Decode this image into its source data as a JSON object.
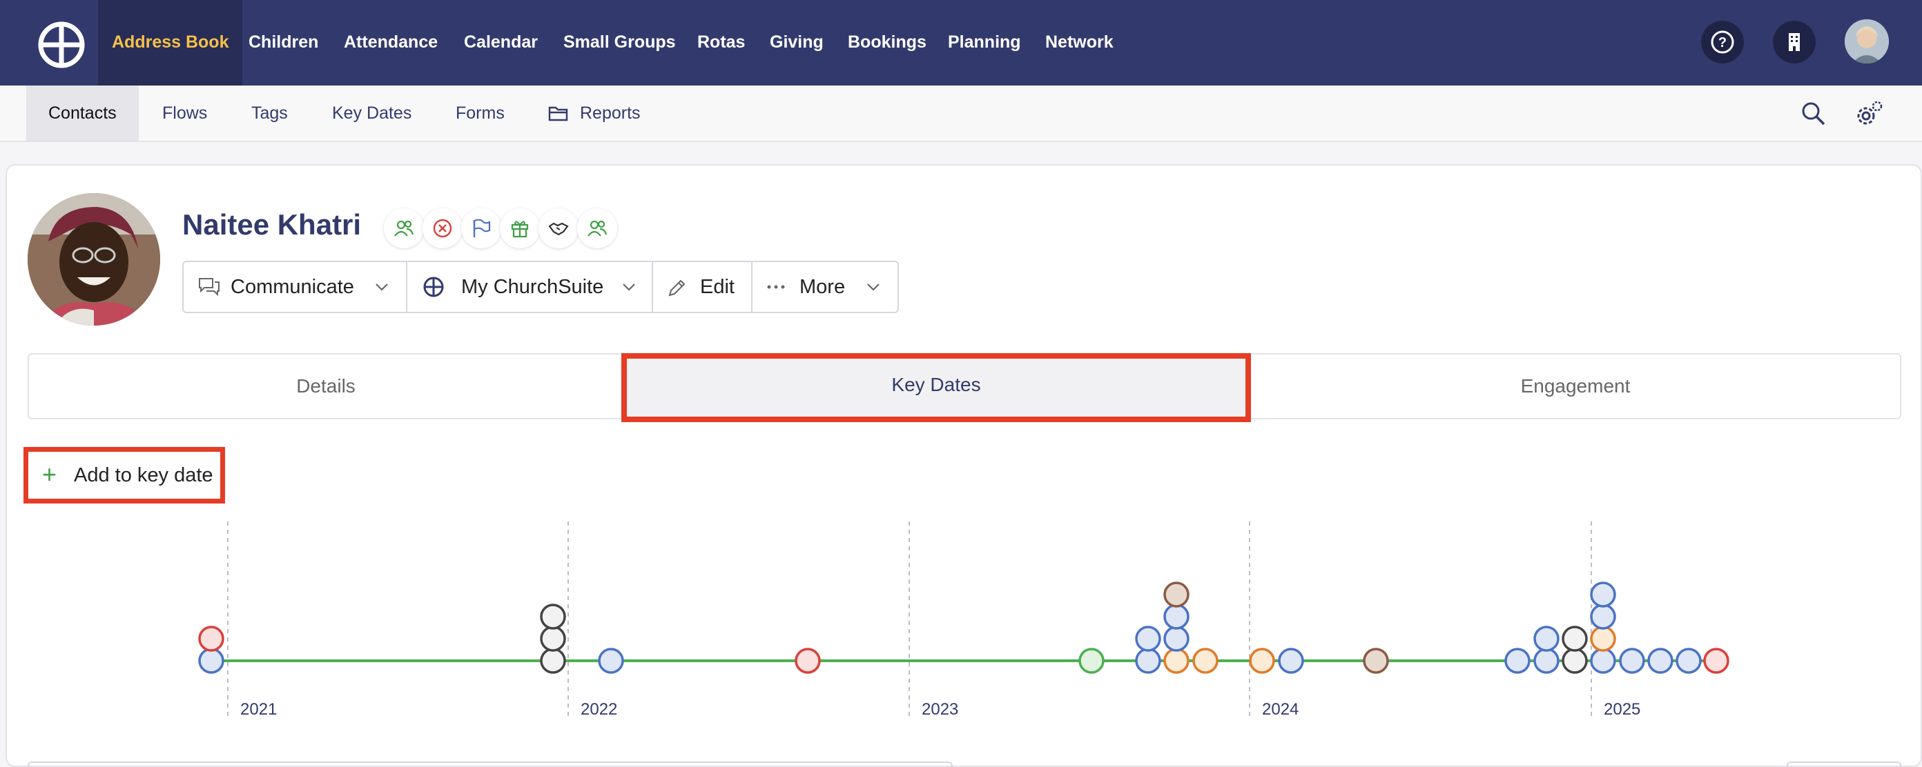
{
  "topnav": {
    "items": [
      {
        "label": "Address Book",
        "active": true
      },
      {
        "label": "Children"
      },
      {
        "label": "Attendance"
      },
      {
        "label": "Calendar"
      },
      {
        "label": "Small Groups"
      },
      {
        "label": "Rotas"
      },
      {
        "label": "Giving"
      },
      {
        "label": "Bookings"
      },
      {
        "label": "Planning"
      },
      {
        "label": "Network"
      }
    ],
    "icons": [
      "help-icon",
      "building-icon",
      "user-avatar"
    ]
  },
  "subnav": {
    "items": [
      {
        "label": "Contacts",
        "active": true
      },
      {
        "label": "Flows"
      },
      {
        "label": "Tags"
      },
      {
        "label": "Key Dates"
      },
      {
        "label": "Forms"
      },
      {
        "label": "Reports",
        "icon": "folder-icon"
      }
    ],
    "icons": [
      "search-icon",
      "settings-icon"
    ]
  },
  "contact": {
    "name": "Naitee Khatri",
    "tag_icons": [
      "users-icon",
      "cancel-icon",
      "flag-icon",
      "gift-icon",
      "handshake-icon",
      "users-icon"
    ]
  },
  "actions": {
    "communicate": "Communicate",
    "churchsuite": "My ChurchSuite",
    "edit": "Edit",
    "more": "More"
  },
  "tabs": {
    "details": "Details",
    "key_dates": "Key Dates",
    "engagement": "Engagement"
  },
  "add_key_date": "Add to key date",
  "timeline": {
    "years": [
      "2021",
      "2022",
      "2023",
      "2024",
      "2025"
    ],
    "colors": {
      "line": "#4caf50",
      "blue": "#4a73c4",
      "red": "#d9403a",
      "dark": "#444444",
      "orange": "#e07b29",
      "green": "#4caf50",
      "brown": "#8a5a44"
    }
  }
}
